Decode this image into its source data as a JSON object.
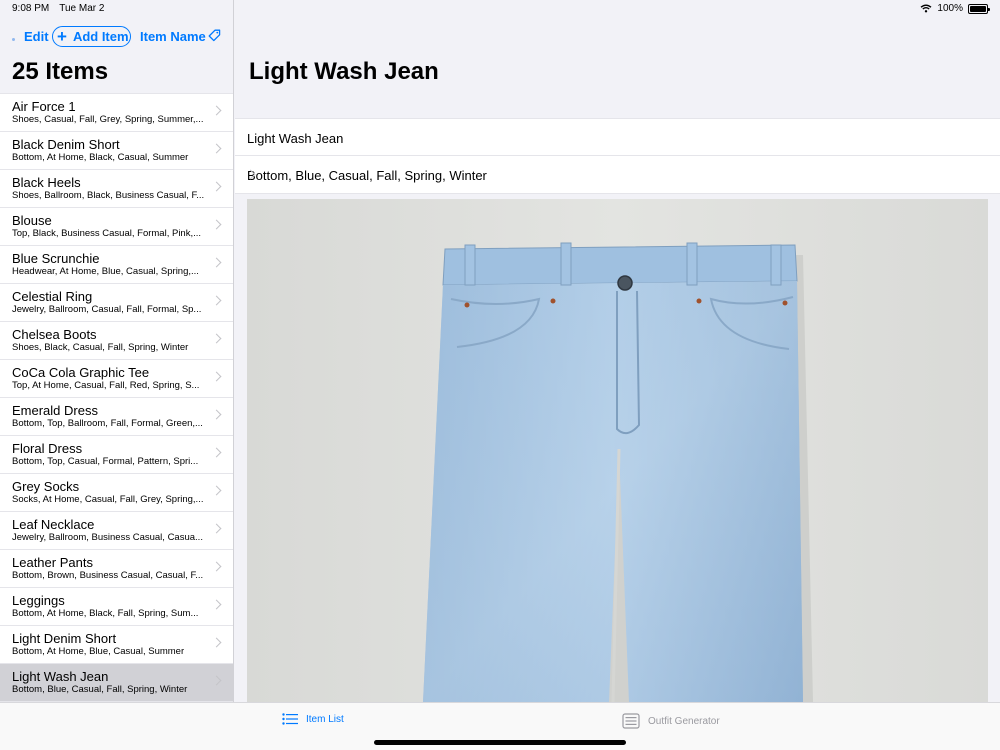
{
  "status": {
    "time": "9:08 PM",
    "date": "Tue Mar 2",
    "battery": "100%"
  },
  "toolbar": {
    "edit_label": "Edit",
    "add_label": "Add Item",
    "sort_label": "Item Name"
  },
  "sidebar": {
    "title": "25 Items",
    "items": [
      {
        "title": "Air Force 1",
        "subtitle": "Shoes, Casual, Fall, Grey, Spring, Summer,..."
      },
      {
        "title": "Black Denim Short",
        "subtitle": "Bottom, At Home, Black, Casual, Summer"
      },
      {
        "title": "Black Heels",
        "subtitle": "Shoes, Ballroom, Black, Business Casual, F..."
      },
      {
        "title": "Blouse",
        "subtitle": "Top, Black, Business Casual, Formal, Pink,..."
      },
      {
        "title": "Blue Scrunchie",
        "subtitle": "Headwear, At Home, Blue, Casual, Spring,..."
      },
      {
        "title": "Celestial Ring",
        "subtitle": "Jewelry, Ballroom, Casual, Fall, Formal, Sp..."
      },
      {
        "title": "Chelsea Boots",
        "subtitle": "Shoes, Black, Casual, Fall, Spring, Winter"
      },
      {
        "title": "CoCa Cola Graphic Tee",
        "subtitle": "Top, At Home, Casual, Fall, Red, Spring, S..."
      },
      {
        "title": "Emerald Dress",
        "subtitle": "Bottom, Top, Ballroom, Fall, Formal, Green,..."
      },
      {
        "title": "Floral Dress",
        "subtitle": "Bottom, Top, Casual, Formal, Pattern, Spri..."
      },
      {
        "title": "Grey Socks",
        "subtitle": "Socks, At Home, Casual, Fall, Grey, Spring,..."
      },
      {
        "title": "Leaf Necklace",
        "subtitle": "Jewelry, Ballroom, Business Casual, Casua..."
      },
      {
        "title": "Leather Pants",
        "subtitle": "Bottom, Brown, Business Casual, Casual, F..."
      },
      {
        "title": "Leggings",
        "subtitle": "Bottom, At Home, Black, Fall, Spring, Sum..."
      },
      {
        "title": "Light Denim Short",
        "subtitle": "Bottom, At Home, Blue, Casual, Summer"
      },
      {
        "title": "Light Wash Jean",
        "subtitle": "Bottom, Blue, Casual, Fall, Spring, Winter",
        "selected": true
      }
    ]
  },
  "detail": {
    "title": "Light Wash Jean",
    "name_value": "Light Wash Jean",
    "tags_value": "Bottom, Blue, Casual, Fall, Spring, Winter",
    "photo_icon": "jeans-photo"
  },
  "tabbar": {
    "tabs": [
      {
        "label": "Item List",
        "icon": "list-icon",
        "active": true
      },
      {
        "label": "Outfit Generator",
        "icon": "keyboard-icon",
        "active": false
      }
    ]
  },
  "colors": {
    "accent": "#007aff",
    "selected_row": "#d1d1d6",
    "background": "#f2f2f7",
    "denim": "#a9c8e4"
  }
}
